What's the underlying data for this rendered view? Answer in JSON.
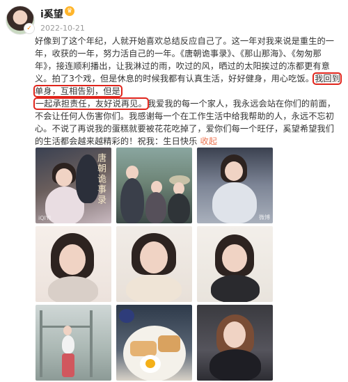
{
  "header": {
    "username": "i奚望",
    "date": "2022-10-21",
    "crown_glyph": "♛",
    "badge_glyph": "✓"
  },
  "post": {
    "text_before": "好像到了这个年纪，人就开始喜欢总结反应自己了。这一年对我来说是重生的一年，收获的一年，努力活自己的一年。《唐朝诡事录》、《那山那海》、《匆匆那年》，接连顺利播出，让我淋过的雨，吹过的风，晒过的太阳挨过的冻都更有意义。拍了3个戏，但是休息的时候我都有认真生活，好好健身，用心吃饭。",
    "highlight_1": "我回到单身，互相告别，但是",
    "highlight_2": "一起承担责任，友好说再见。",
    "text_after": "我爱我的每一个家人，我永远会站在你们的前面，不会让任何人伤害你们。我感谢每一个在工作生活中给我帮助的人，永远不忘初心。不说了再说我的蛋糕就要被花花吃掉了，爱你们每一个旺仔，奚望希望我们的生活都会越来越精彩的！祝我：生日快乐 ",
    "link": "收起"
  },
  "photos": {
    "p1_caption": "唐朝诡事录",
    "p1_watermark": "iQIYI",
    "p3_watermark": "微博"
  },
  "colors": {
    "highlight_border": "#e0241b",
    "link": "#eb7350",
    "date": "#9a9a9a"
  }
}
